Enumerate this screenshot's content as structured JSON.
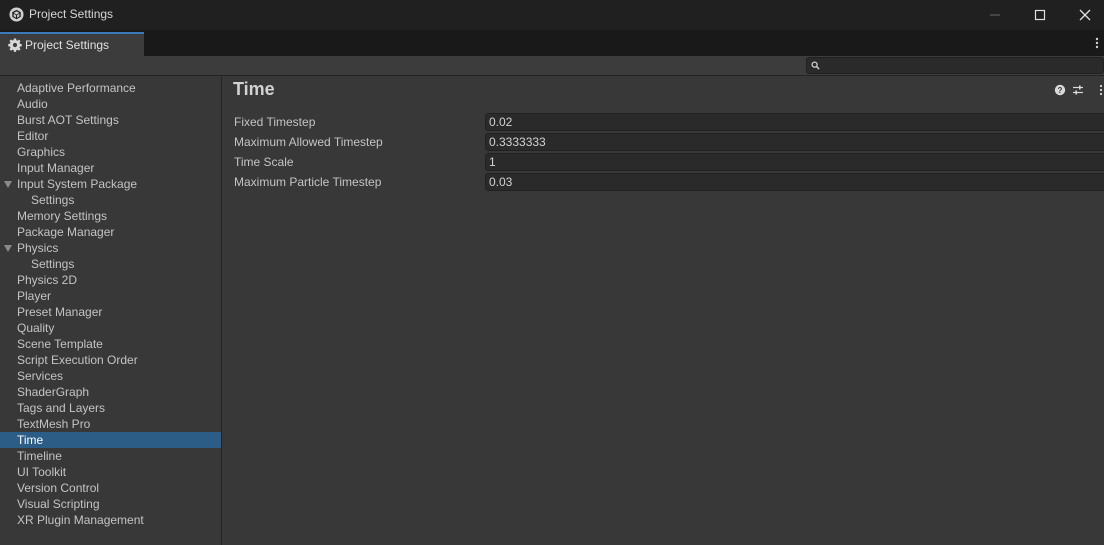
{
  "window": {
    "title": "Project Settings",
    "icon": "unity-cube-icon",
    "controls": [
      "minimize",
      "maximize",
      "close"
    ]
  },
  "tab": {
    "label": "Project Settings",
    "icon": "gear-icon"
  },
  "search": {
    "value": "",
    "placeholder": ""
  },
  "sidebar": {
    "items": [
      {
        "label": "Adaptive Performance"
      },
      {
        "label": "Audio"
      },
      {
        "label": "Burst AOT Settings"
      },
      {
        "label": "Editor"
      },
      {
        "label": "Graphics"
      },
      {
        "label": "Input Manager"
      },
      {
        "label": "Input System Package",
        "expanded": true
      },
      {
        "label": "Settings",
        "child": true
      },
      {
        "label": "Memory Settings"
      },
      {
        "label": "Package Manager"
      },
      {
        "label": "Physics",
        "expanded": true
      },
      {
        "label": "Settings",
        "child": true
      },
      {
        "label": "Physics 2D"
      },
      {
        "label": "Player"
      },
      {
        "label": "Preset Manager"
      },
      {
        "label": "Quality"
      },
      {
        "label": "Scene Template"
      },
      {
        "label": "Script Execution Order"
      },
      {
        "label": "Services"
      },
      {
        "label": "ShaderGraph"
      },
      {
        "label": "Tags and Layers"
      },
      {
        "label": "TextMesh Pro"
      },
      {
        "label": "Time",
        "selected": true
      },
      {
        "label": "Timeline"
      },
      {
        "label": "UI Toolkit"
      },
      {
        "label": "Version Control"
      },
      {
        "label": "Visual Scripting"
      },
      {
        "label": "XR Plugin Management"
      }
    ]
  },
  "main": {
    "title": "Time",
    "header_icons": [
      "help-icon",
      "preset-icon",
      "more-options-icon"
    ],
    "properties": [
      {
        "label": "Fixed Timestep",
        "value": "0.02"
      },
      {
        "label": "Maximum Allowed Timestep",
        "value": "0.3333333"
      },
      {
        "label": "Time Scale",
        "value": "1"
      },
      {
        "label": "Maximum Particle Timestep",
        "value": "0.03"
      }
    ]
  },
  "colors": {
    "selection": "#2c5d87",
    "tab_accent": "#3a79bb",
    "panel": "#383838",
    "titlebar": "#202020",
    "field": "#2a2a2a"
  }
}
